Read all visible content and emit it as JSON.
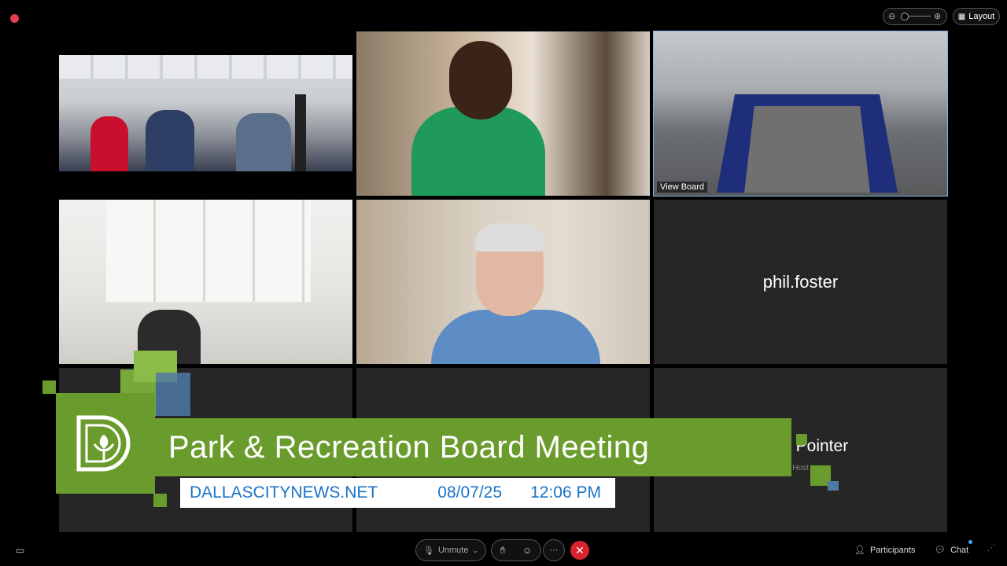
{
  "window": {
    "layout_label": "Layout",
    "record_icon": "record-dot-icon"
  },
  "tiles": {
    "phil": {
      "name": "phil.foster"
    },
    "board": {
      "label": "View Board"
    },
    "toyia": {
      "name": "Toyia Pointer",
      "sub": "Host"
    }
  },
  "banner": {
    "title": "Park & Recreation Board Meeting",
    "website": "DALLASCITYNEWS.NET",
    "date": "08/07/25",
    "time": "12:06 PM"
  },
  "toolbar": {
    "unmute_label": "Unmute",
    "participants_label": "Participants",
    "chat_label": "Chat"
  },
  "colors": {
    "banner_green": "#6a9c2d",
    "link_blue": "#1a73c7",
    "leave_red": "#d9232d",
    "active_border": "#7fb5e6"
  }
}
